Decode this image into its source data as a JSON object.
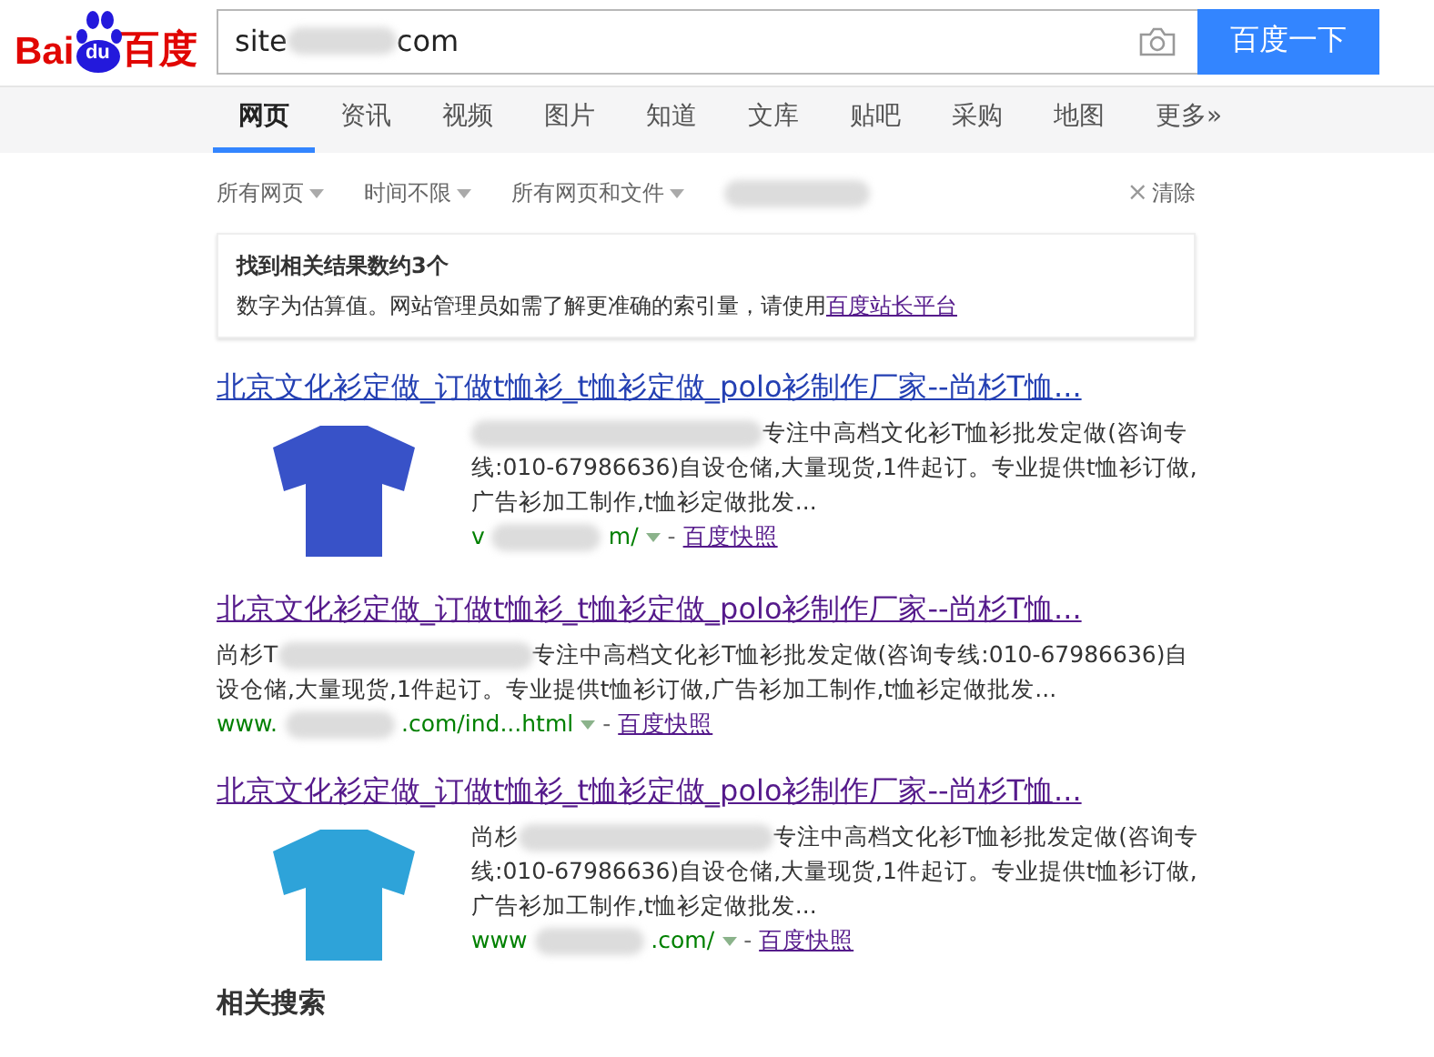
{
  "logo": {
    "left": "Bai",
    "paw": "du",
    "right": "百度"
  },
  "search": {
    "value_start": "site",
    "value_end": "com",
    "button": "百度一下"
  },
  "tabs": [
    {
      "label": "网页",
      "selected": true
    },
    {
      "label": "资讯",
      "selected": false
    },
    {
      "label": "视频",
      "selected": false
    },
    {
      "label": "图片",
      "selected": false
    },
    {
      "label": "知道",
      "selected": false
    },
    {
      "label": "文库",
      "selected": false
    },
    {
      "label": "贴吧",
      "selected": false
    },
    {
      "label": "采购",
      "selected": false
    },
    {
      "label": "地图",
      "selected": false
    },
    {
      "label": "更多»",
      "selected": false
    }
  ],
  "filters": [
    {
      "kind": "dropdown",
      "label": "所有网页"
    },
    {
      "kind": "dropdown",
      "label": "时间不限"
    },
    {
      "kind": "dropdown",
      "label": "所有网页和文件"
    },
    {
      "kind": "blurred"
    }
  ],
  "clear": {
    "icon": "×",
    "label": "清除"
  },
  "notice": {
    "title": "找到相关结果数约3个",
    "text": "数字为估算值。网站管理员如需了解更准确的索引量，请使用",
    "link": "百度站长平台"
  },
  "results": [
    {
      "title": "北京文化衫定做_订做t恤衫_t恤衫定做_polo衫制作厂家--尚杉T恤...",
      "visited": false,
      "image": {
        "color": "#3852c8"
      },
      "snippet": "专注中高档文化衫T恤衫批发定做(咨询专线:010-67986636)自设仓储,大量现货,1件起订。专业提供t恤衫订做,广告衫加工制作,t恤衫定做批发...",
      "url_start": "v",
      "url_end": "m/",
      "separator": "-",
      "snapshot": "百度快照"
    },
    {
      "title": "北京文化衫定做_订做t恤衫_t恤衫定做_polo衫制作厂家--尚杉T恤...",
      "visited": true,
      "snippet_start": "尚杉T",
      "snippet": "专注中高档文化衫T恤衫批发定做(咨询专线:010-67986636)自设仓储,大量现货,1件起订。专业提供t恤衫订做,广告衫加工制作,t恤衫定做批发...",
      "url_start": "www.",
      "url_end": ".com/ind...html",
      "separator": "-",
      "snapshot": "百度快照"
    },
    {
      "title": "北京文化衫定做_订做t恤衫_t恤衫定做_polo衫制作厂家--尚杉T恤...",
      "visited": true,
      "image": {
        "color": "#2ea3d9"
      },
      "snippet_start": "尚杉",
      "snippet": "专注中高档文化衫T恤衫批发定做(咨询专线:010-67986636)自设仓储,大量现货,1件起订。专业提供t恤衫订做,广告衫加工制作,t恤衫定做批发...",
      "url_start": "www",
      "url_end": ".com/",
      "separator": "-",
      "snapshot": "百度快照"
    }
  ],
  "related": {
    "title": "相关搜索"
  }
}
